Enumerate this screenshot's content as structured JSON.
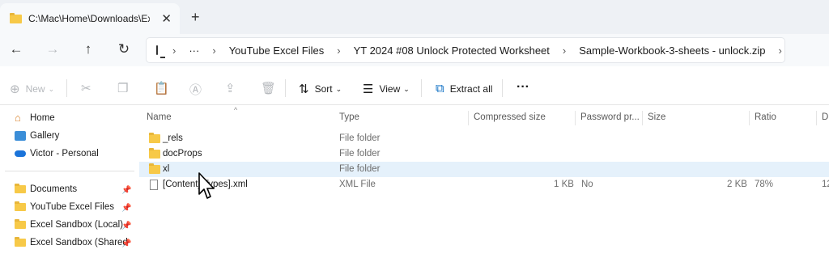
{
  "tab": {
    "title": "C:\\Mac\\Home\\Downloads\\Exc",
    "close_glyph": "✕",
    "add_glyph": "+"
  },
  "nav": {
    "back_icon": "arrow-left-icon",
    "forward_icon": "arrow-right-icon",
    "up_icon": "arrow-up-icon",
    "refresh_icon": "refresh-icon"
  },
  "address": {
    "ellipsis": "···",
    "segments": [
      "YouTube Excel Files",
      "YT 2024 #08 Unlock Protected Worksheet",
      "Sample-Workbook-3-sheets - unlock.zip"
    ]
  },
  "toolbar": {
    "new_label": "New",
    "sort_label": "Sort",
    "view_label": "View",
    "extract_label": "Extract all",
    "more_label": "···"
  },
  "sidebar": {
    "items": [
      {
        "label": "Home"
      },
      {
        "label": "Gallery"
      },
      {
        "label": "Victor - Personal"
      },
      {
        "label": "Documents"
      },
      {
        "label": "YouTube Excel Files"
      },
      {
        "label": "Excel Sandbox (Local)"
      },
      {
        "label": "Excel Sandbox (Shared"
      }
    ]
  },
  "columns": {
    "name": "Name",
    "type": "Type",
    "compressed": "Compressed size",
    "password": "Password pr...",
    "size": "Size",
    "ratio": "Ratio",
    "date": "D"
  },
  "files": [
    {
      "name": "_rels",
      "type": "File folder",
      "compressed": "",
      "password": "",
      "size": "",
      "ratio": "",
      "date": ""
    },
    {
      "name": "docProps",
      "type": "File folder",
      "compressed": "",
      "password": "",
      "size": "",
      "ratio": "",
      "date": ""
    },
    {
      "name": "xl",
      "type": "File folder",
      "compressed": "",
      "password": "",
      "size": "",
      "ratio": "",
      "date": ""
    },
    {
      "name": "[Content_Types].xml",
      "type": "XML File",
      "compressed": "1 KB",
      "password": "No",
      "size": "2 KB",
      "ratio": "78%",
      "date": "12"
    }
  ],
  "colors": {
    "folder": "#f7c948",
    "hover_row": "#e5f1fb",
    "accent": "#0067c0"
  }
}
